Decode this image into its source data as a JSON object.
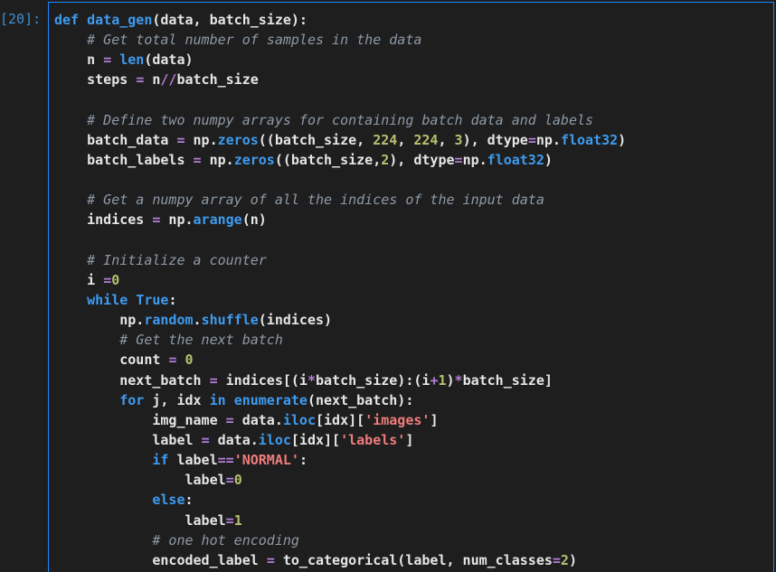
{
  "prompt": "[20]:",
  "code_lines": [
    [
      [
        "kw",
        "def "
      ],
      [
        "fn",
        "data_gen"
      ],
      [
        "var",
        "(data, batch_size):"
      ]
    ],
    [
      [
        "var",
        "    "
      ],
      [
        "cm",
        "# Get total number of samples in the data"
      ]
    ],
    [
      [
        "var",
        "    n "
      ],
      [
        "op",
        "="
      ],
      [
        "var",
        " "
      ],
      [
        "fn",
        "len"
      ],
      [
        "var",
        "(data)"
      ]
    ],
    [
      [
        "var",
        "    steps "
      ],
      [
        "op",
        "="
      ],
      [
        "var",
        " n"
      ],
      [
        "op",
        "//"
      ],
      [
        "var",
        "batch_size"
      ]
    ],
    [],
    [
      [
        "var",
        "    "
      ],
      [
        "cm",
        "# Define two numpy arrays for containing batch data and labels"
      ]
    ],
    [
      [
        "var",
        "    batch_data "
      ],
      [
        "op",
        "="
      ],
      [
        "var",
        " np."
      ],
      [
        "attr",
        "zeros"
      ],
      [
        "var",
        "((batch_size, "
      ],
      [
        "num",
        "224"
      ],
      [
        "var",
        ", "
      ],
      [
        "num",
        "224"
      ],
      [
        "var",
        ", "
      ],
      [
        "num",
        "3"
      ],
      [
        "var",
        "), dtype"
      ],
      [
        "op",
        "="
      ],
      [
        "var",
        "np."
      ],
      [
        "attr",
        "float32"
      ],
      [
        "var",
        ")"
      ]
    ],
    [
      [
        "var",
        "    batch_labels "
      ],
      [
        "op",
        "="
      ],
      [
        "var",
        " np."
      ],
      [
        "attr",
        "zeros"
      ],
      [
        "var",
        "((batch_size,"
      ],
      [
        "num",
        "2"
      ],
      [
        "var",
        "), dtype"
      ],
      [
        "op",
        "="
      ],
      [
        "var",
        "np."
      ],
      [
        "attr",
        "float32"
      ],
      [
        "var",
        ")"
      ]
    ],
    [],
    [
      [
        "var",
        "    "
      ],
      [
        "cm",
        "# Get a numpy array of all the indices of the input data"
      ]
    ],
    [
      [
        "var",
        "    indices "
      ],
      [
        "op",
        "="
      ],
      [
        "var",
        " np."
      ],
      [
        "attr",
        "arange"
      ],
      [
        "var",
        "(n)"
      ]
    ],
    [],
    [
      [
        "var",
        "    "
      ],
      [
        "cm",
        "# Initialize a counter"
      ]
    ],
    [
      [
        "var",
        "    i "
      ],
      [
        "op",
        "="
      ],
      [
        "num",
        "0"
      ]
    ],
    [
      [
        "var",
        "    "
      ],
      [
        "kw",
        "while"
      ],
      [
        "var",
        " "
      ],
      [
        "kw",
        "True"
      ],
      [
        "var",
        ":"
      ]
    ],
    [
      [
        "var",
        "        np."
      ],
      [
        "attr",
        "random"
      ],
      [
        "var",
        "."
      ],
      [
        "attr",
        "shuffle"
      ],
      [
        "var",
        "(indices)"
      ]
    ],
    [
      [
        "var",
        "        "
      ],
      [
        "cm",
        "# Get the next batch"
      ]
    ],
    [
      [
        "var",
        "        count "
      ],
      [
        "op",
        "="
      ],
      [
        "var",
        " "
      ],
      [
        "num",
        "0"
      ]
    ],
    [
      [
        "var",
        "        next_batch "
      ],
      [
        "op",
        "="
      ],
      [
        "var",
        " indices[(i"
      ],
      [
        "op",
        "*"
      ],
      [
        "var",
        "batch_size):(i"
      ],
      [
        "op",
        "+"
      ],
      [
        "num",
        "1"
      ],
      [
        "var",
        ")"
      ],
      [
        "op",
        "*"
      ],
      [
        "var",
        "batch_size]"
      ]
    ],
    [
      [
        "var",
        "        "
      ],
      [
        "kw",
        "for"
      ],
      [
        "var",
        " j, idx "
      ],
      [
        "kw",
        "in"
      ],
      [
        "var",
        " "
      ],
      [
        "fn",
        "enumerate"
      ],
      [
        "var",
        "(next_batch):"
      ]
    ],
    [
      [
        "var",
        "            img_name "
      ],
      [
        "op",
        "="
      ],
      [
        "var",
        " data."
      ],
      [
        "attr",
        "iloc"
      ],
      [
        "var",
        "[idx]["
      ],
      [
        "str",
        "'images'"
      ],
      [
        "var",
        "]"
      ]
    ],
    [
      [
        "var",
        "            label "
      ],
      [
        "op",
        "="
      ],
      [
        "var",
        " data."
      ],
      [
        "attr",
        "iloc"
      ],
      [
        "var",
        "[idx]["
      ],
      [
        "str",
        "'labels'"
      ],
      [
        "var",
        "]"
      ]
    ],
    [
      [
        "var",
        "            "
      ],
      [
        "kw",
        "if"
      ],
      [
        "var",
        " label"
      ],
      [
        "op",
        "=="
      ],
      [
        "str",
        "'NORMAL'"
      ],
      [
        "var",
        ":"
      ]
    ],
    [
      [
        "var",
        "                label"
      ],
      [
        "op",
        "="
      ],
      [
        "num",
        "0"
      ]
    ],
    [
      [
        "var",
        "            "
      ],
      [
        "kw",
        "else"
      ],
      [
        "var",
        ":"
      ]
    ],
    [
      [
        "var",
        "                label"
      ],
      [
        "op",
        "="
      ],
      [
        "num",
        "1"
      ]
    ],
    [
      [
        "var",
        "            "
      ],
      [
        "cm",
        "# one hot encoding"
      ]
    ],
    [
      [
        "var",
        "            encoded_label "
      ],
      [
        "op",
        "="
      ],
      [
        "var",
        " to_categorical(label, num_classes"
      ],
      [
        "op",
        "="
      ],
      [
        "num",
        "2"
      ],
      [
        "var",
        ")"
      ]
    ]
  ]
}
